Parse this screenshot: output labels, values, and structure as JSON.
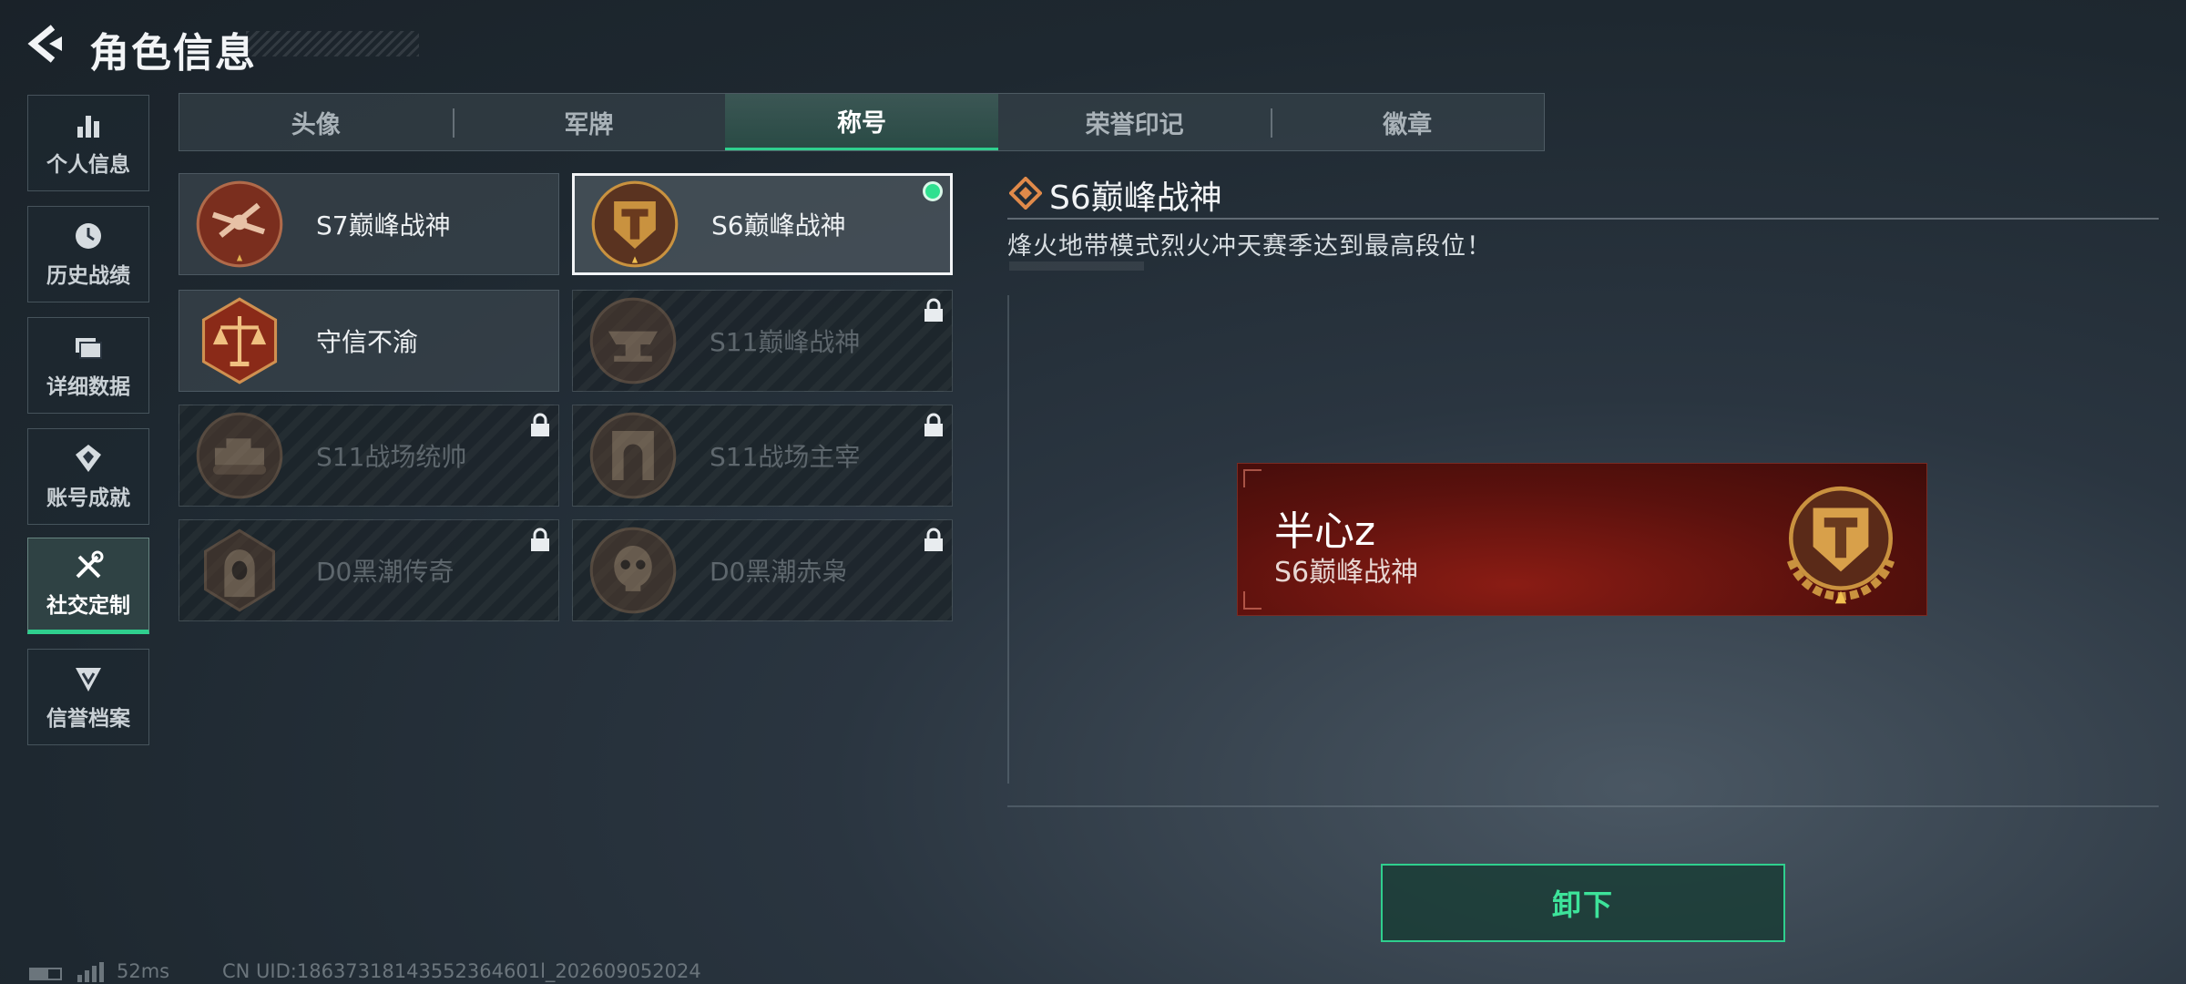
{
  "header": {
    "title": "角色信息"
  },
  "sidebar": {
    "items": [
      {
        "label": "个人信息",
        "icon": "bar-chart-icon"
      },
      {
        "label": "历史战绩",
        "icon": "clock-icon"
      },
      {
        "label": "详细数据",
        "icon": "folder-icon"
      },
      {
        "label": "账号成就",
        "icon": "achievement-icon"
      },
      {
        "label": "社交定制",
        "icon": "tools-icon",
        "active": true
      },
      {
        "label": "信誉档案",
        "icon": "credit-icon"
      }
    ]
  },
  "tabs": [
    {
      "label": "头像"
    },
    {
      "label": "军牌"
    },
    {
      "label": "称号",
      "active": true
    },
    {
      "label": "荣誉印记"
    },
    {
      "label": "徽章"
    }
  ],
  "titles": [
    {
      "name": "S7巅峰战神",
      "locked": false,
      "icon": "crossbow-medal-icon"
    },
    {
      "name": "S6巅峰战神",
      "locked": false,
      "selected": true,
      "equipped": true,
      "icon": "t-shield-medal-icon"
    },
    {
      "name": "守信不渝",
      "locked": false,
      "icon": "scales-medal-icon"
    },
    {
      "name": "S11巅峰战神",
      "locked": true,
      "icon": "anvil-medal-icon"
    },
    {
      "name": "S11战场统帅",
      "locked": true,
      "icon": "tank-medal-icon"
    },
    {
      "name": "S11战场主宰",
      "locked": true,
      "icon": "arch-medal-icon"
    },
    {
      "name": "D0黑潮传奇",
      "locked": true,
      "icon": "hooded-figure-medal-icon"
    },
    {
      "name": "D0黑潮赤枭",
      "locked": true,
      "icon": "skull-medal-icon"
    }
  ],
  "detail": {
    "title": "S6巅峰战神",
    "description": "烽火地带模式烈火冲天赛季达到最高段位！"
  },
  "preview": {
    "player_name": "半心z",
    "title": "S6巅峰战神"
  },
  "actions": {
    "unequip_label": "卸下"
  },
  "status": {
    "ping": "52ms",
    "uid": "CN UID:18637318143552364601l_202609052024"
  },
  "colors": {
    "accent_green": "#2fcf8e",
    "plate_red": "#8a1c14",
    "gold": "#c9923f"
  }
}
